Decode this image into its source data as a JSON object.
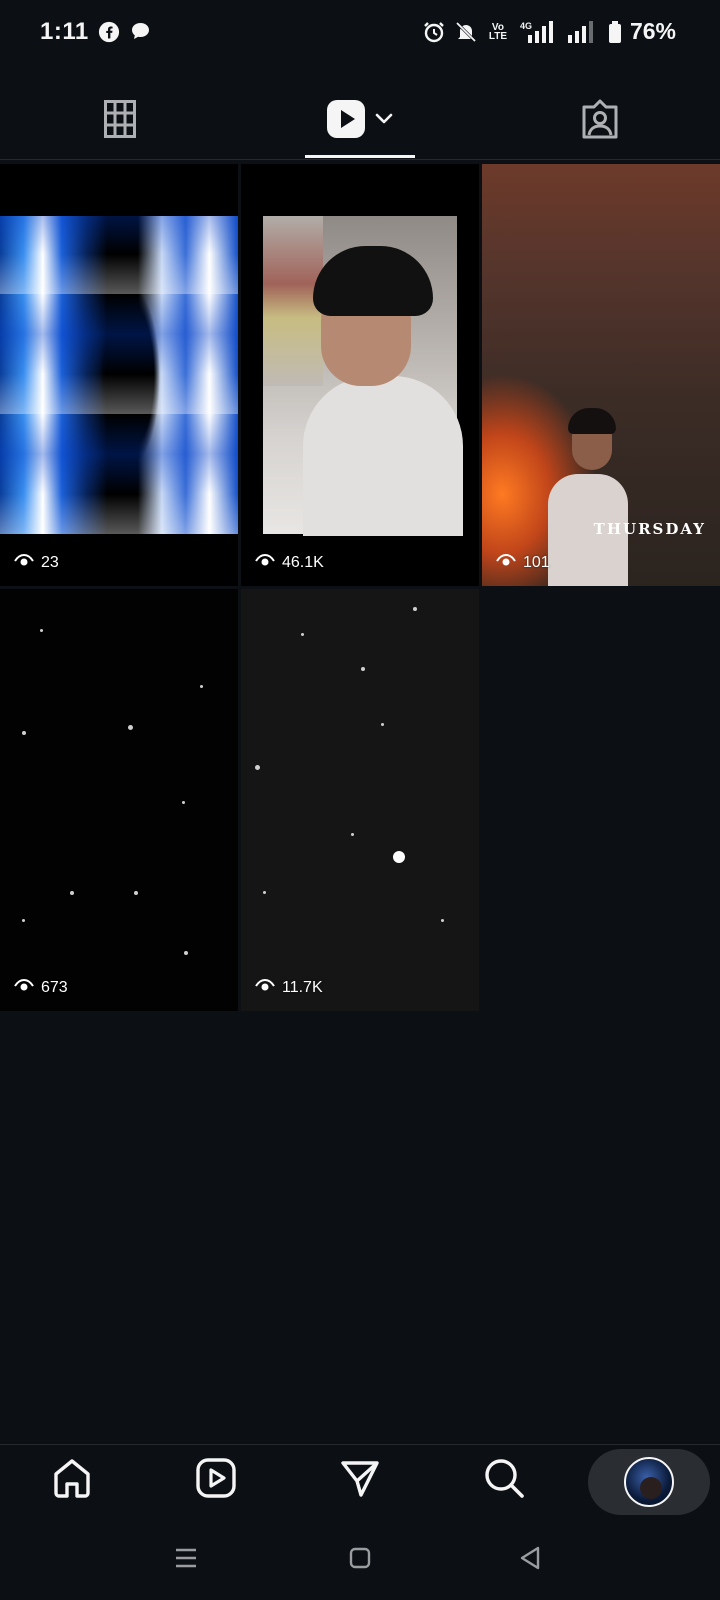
{
  "status_bar": {
    "time": "1:11",
    "network_label": "4G",
    "volte_label": "Vo LTE",
    "battery": "76%"
  },
  "tabs": [
    {
      "name": "grid",
      "icon": "grid-icon",
      "active": false
    },
    {
      "name": "reels",
      "icon": "reels-icon",
      "active": true
    },
    {
      "name": "tagged",
      "icon": "tagged-icon",
      "active": false
    }
  ],
  "reels": [
    {
      "views": "23"
    },
    {
      "views": "46.1K"
    },
    {
      "views": "101",
      "overlay_text": "THURSDAY"
    },
    {
      "views": "673"
    },
    {
      "views": "11.7K"
    }
  ],
  "bottom_nav": [
    {
      "name": "home",
      "icon": "home-icon"
    },
    {
      "name": "reels",
      "icon": "reels-icon"
    },
    {
      "name": "direct",
      "icon": "send-icon"
    },
    {
      "name": "search",
      "icon": "search-icon"
    },
    {
      "name": "profile",
      "icon": "avatar"
    }
  ],
  "colors": {
    "background": "#0c1014",
    "foreground": "#f5f5f5",
    "divider": "#262a2f"
  }
}
